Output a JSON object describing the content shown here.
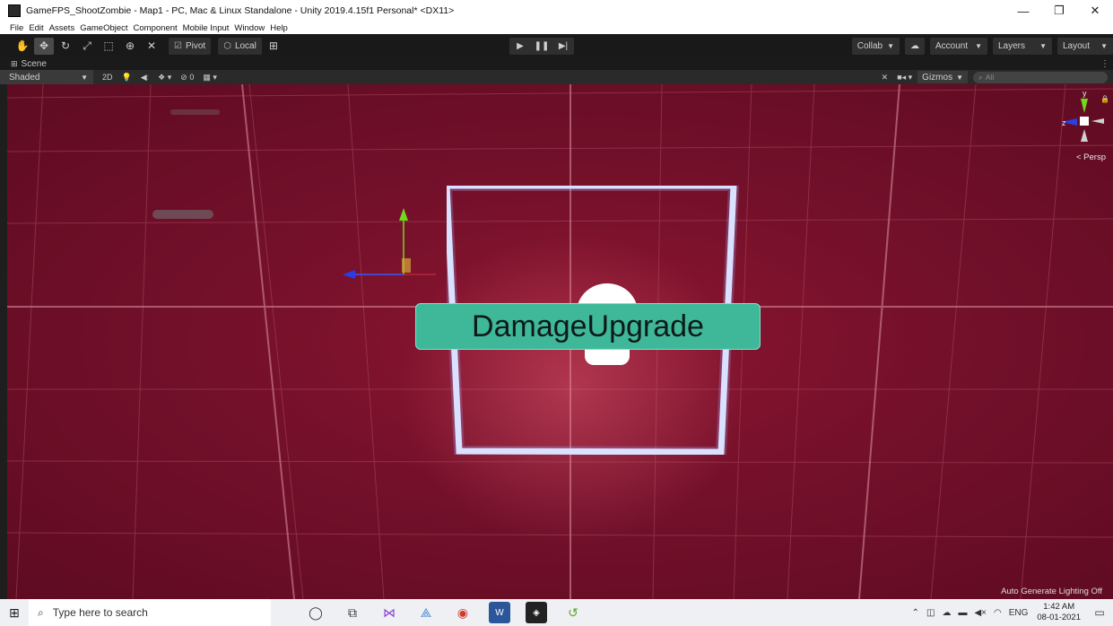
{
  "window": {
    "title": "GameFPS_ShootZombie - Map1 - PC, Mac & Linux Standalone - Unity 2019.4.15f1 Personal* <DX11>",
    "controls": [
      "—",
      "❐",
      "✕"
    ]
  },
  "menubar": {
    "items": [
      "File",
      "Edit",
      "Assets",
      "GameObject",
      "Component",
      "Mobile Input",
      "Window",
      "Help"
    ]
  },
  "toolbar": {
    "pivot_label": "Pivot",
    "local_label": "Local",
    "collab_label": "Collab",
    "account_label": "Account",
    "layers_label": "Layers",
    "layout_label": "Layout"
  },
  "scene_tab": {
    "label": "Scene"
  },
  "scene_controls": {
    "shading_mode": "Shaded",
    "mode_2d": "2D",
    "hidden_count": "0",
    "gizmos_label": "Gizmos",
    "search_placeholder": "All"
  },
  "viewport": {
    "object_label": "DamageUpgrade",
    "projection_label": "Persp",
    "lighting_status": "Auto Generate Lighting Off",
    "axis_labels": {
      "y": "y",
      "z": "z"
    },
    "colors": {
      "background": "#74102a",
      "label_card": "#3fb89a",
      "frame": "#eef2ff"
    }
  },
  "taskbar": {
    "search_placeholder": "Type here to search",
    "icons": [
      "cortana-icon",
      "task-view-icon",
      "visual-studio-icon",
      "unity-hub-icon",
      "chrome-icon",
      "word-icon",
      "unity-icon",
      "sync-icon"
    ],
    "language": "ENG",
    "time": "1:42 AM",
    "date": "08-01-2021"
  }
}
